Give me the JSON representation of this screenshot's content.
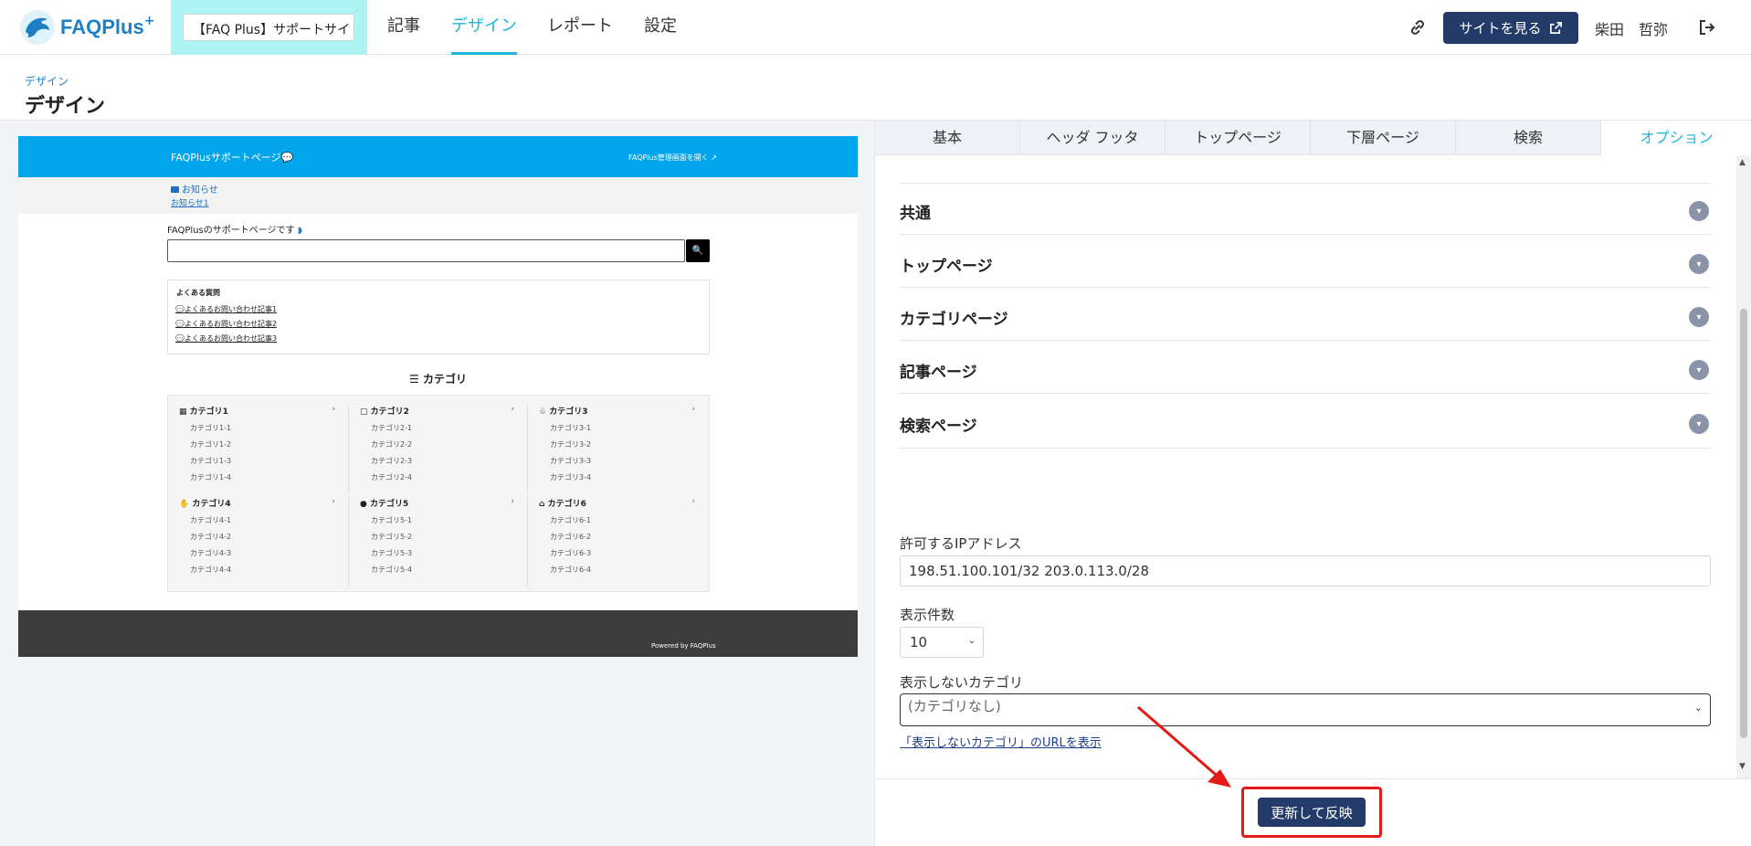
{
  "topbar": {
    "brand": "FAQPlus",
    "site_select": "【FAQ Plus】サポートサイト",
    "nav": [
      {
        "label": "記事"
      },
      {
        "label": "デザイン"
      },
      {
        "label": "レポート"
      },
      {
        "label": "設定"
      }
    ],
    "view_site_label": "サイトを見る",
    "user_name": "柴田　哲弥"
  },
  "page_head": {
    "breadcrumb": "デザイン",
    "title": "デザイン"
  },
  "preview": {
    "site_title": "FAQPlusサポートページ💬",
    "admin_link": "FAQPlus管理画面を開く",
    "news_title": "お知らせ",
    "news_link": "お知らせ1",
    "welcome": "FAQPlusのサポートページです",
    "search_btn": "🔍",
    "faq_title": "よくある質問",
    "faq_items": [
      "よくあるお問い合わせ記事1",
      "よくあるお問い合わせ記事2",
      "よくあるお問い合わせ記事3"
    ],
    "category_heading": "☰ カテゴリ",
    "categories": [
      {
        "name": "カテゴリ1",
        "icon": "▦",
        "subs": [
          "カテゴリ1-1",
          "カテゴリ1-2",
          "カテゴリ1-3",
          "カテゴリ1-4"
        ]
      },
      {
        "name": "カテゴリ2",
        "icon": "▢",
        "subs": [
          "カテゴリ2-1",
          "カテゴリ2-2",
          "カテゴリ2-3",
          "カテゴリ2-4"
        ]
      },
      {
        "name": "カテゴリ3",
        "icon": "♧",
        "subs": [
          "カテゴリ3-1",
          "カテゴリ3-2",
          "カテゴリ3-3",
          "カテゴリ3-4"
        ]
      },
      {
        "name": "カテゴリ4",
        "icon": "✋",
        "subs": [
          "カテゴリ4-1",
          "カテゴリ4-2",
          "カテゴリ4-3",
          "カテゴリ4-4"
        ]
      },
      {
        "name": "カテゴリ5",
        "icon": "●",
        "subs": [
          "カテゴリ5-1",
          "カテゴリ5-2",
          "カテゴリ5-3",
          "カテゴリ5-4"
        ]
      },
      {
        "name": "カテゴリ6",
        "icon": "⌂",
        "subs": [
          "カテゴリ6-1",
          "カテゴリ6-2",
          "カテゴリ6-3",
          "カテゴリ6-4"
        ]
      }
    ],
    "arrow": "›",
    "powered": "Powered by FAQPlus"
  },
  "panel": {
    "tabs": [
      {
        "label": "基本"
      },
      {
        "label": "ヘッダ フッタ"
      },
      {
        "label": "トップページ"
      },
      {
        "label": "下層ページ"
      },
      {
        "label": "検索"
      },
      {
        "label": "オプション"
      }
    ],
    "accordions": [
      {
        "title": "共通"
      },
      {
        "title": "トップページ"
      },
      {
        "title": "カテゴリページ"
      },
      {
        "title": "記事ページ"
      },
      {
        "title": "検索ページ"
      }
    ],
    "ip_label": "許可するIPアドレス",
    "ip_value": "198.51.100.101/32 203.0.113.0/28",
    "count_label": "表示件数",
    "count_value": "10",
    "hidden_cat_label": "表示しないカテゴリ",
    "hidden_cat_value": "(カテゴリなし)",
    "url_link": "「表示しないカテゴリ」のURLを表示",
    "update_button": "更新して反映"
  },
  "colors": {
    "accent": "#1fb5d6",
    "primary_button": "#243b69",
    "preview_header": "#00a5ec",
    "highlight": "#e61919"
  }
}
